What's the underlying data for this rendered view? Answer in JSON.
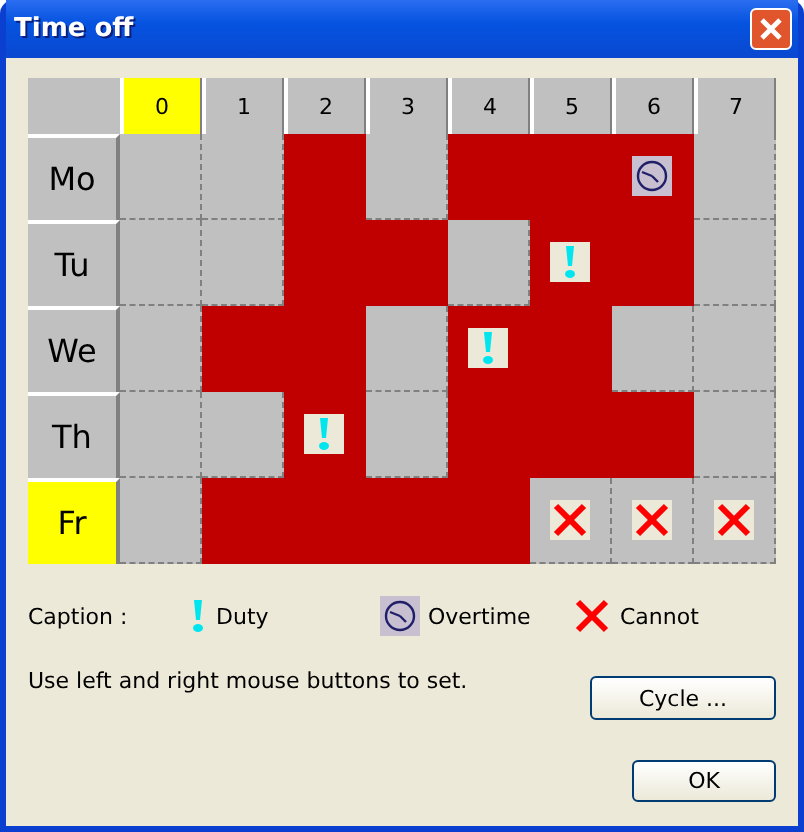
{
  "window": {
    "title": "Time off"
  },
  "columns": [
    {
      "label": "0",
      "selected": true
    },
    {
      "label": "1",
      "selected": false
    },
    {
      "label": "2",
      "selected": false
    },
    {
      "label": "3",
      "selected": false
    },
    {
      "label": "4",
      "selected": false
    },
    {
      "label": "5",
      "selected": false
    },
    {
      "label": "6",
      "selected": false
    },
    {
      "label": "7",
      "selected": false
    }
  ],
  "rows": [
    {
      "label": "Mo",
      "selected": false,
      "cells": [
        {
          "blocked": false
        },
        {
          "blocked": false
        },
        {
          "blocked": true
        },
        {
          "blocked": false
        },
        {
          "blocked": true
        },
        {
          "blocked": true
        },
        {
          "blocked": true,
          "kind": "overtime"
        },
        {
          "blocked": false
        }
      ]
    },
    {
      "label": "Tu",
      "selected": false,
      "cells": [
        {
          "blocked": false
        },
        {
          "blocked": false
        },
        {
          "blocked": true
        },
        {
          "blocked": true
        },
        {
          "blocked": false
        },
        {
          "blocked": true,
          "kind": "duty"
        },
        {
          "blocked": true
        },
        {
          "blocked": false
        }
      ]
    },
    {
      "label": "We",
      "selected": false,
      "cells": [
        {
          "blocked": false
        },
        {
          "blocked": true
        },
        {
          "blocked": true
        },
        {
          "blocked": false
        },
        {
          "blocked": true,
          "kind": "duty"
        },
        {
          "blocked": true
        },
        {
          "blocked": false
        },
        {
          "blocked": false
        }
      ]
    },
    {
      "label": "Th",
      "selected": false,
      "cells": [
        {
          "blocked": false
        },
        {
          "blocked": false
        },
        {
          "blocked": true,
          "kind": "duty"
        },
        {
          "blocked": false
        },
        {
          "blocked": true
        },
        {
          "blocked": true
        },
        {
          "blocked": true
        },
        {
          "blocked": false
        }
      ]
    },
    {
      "label": "Fr",
      "selected": true,
      "cells": [
        {
          "blocked": false
        },
        {
          "blocked": true
        },
        {
          "blocked": true
        },
        {
          "blocked": true
        },
        {
          "blocked": true
        },
        {
          "blocked": false,
          "kind": "cannot"
        },
        {
          "blocked": false,
          "kind": "cannot"
        },
        {
          "blocked": false,
          "kind": "cannot"
        }
      ]
    }
  ],
  "caption": {
    "label": "Caption :",
    "items": [
      {
        "kind": "duty",
        "label": "Duty"
      },
      {
        "kind": "overtime",
        "label": "Overtime"
      },
      {
        "kind": "cannot",
        "label": "Cannot"
      }
    ]
  },
  "instruction": "Use left and right mouse buttons to set.",
  "buttons": {
    "cycle": "Cycle ...",
    "ok": "OK"
  }
}
